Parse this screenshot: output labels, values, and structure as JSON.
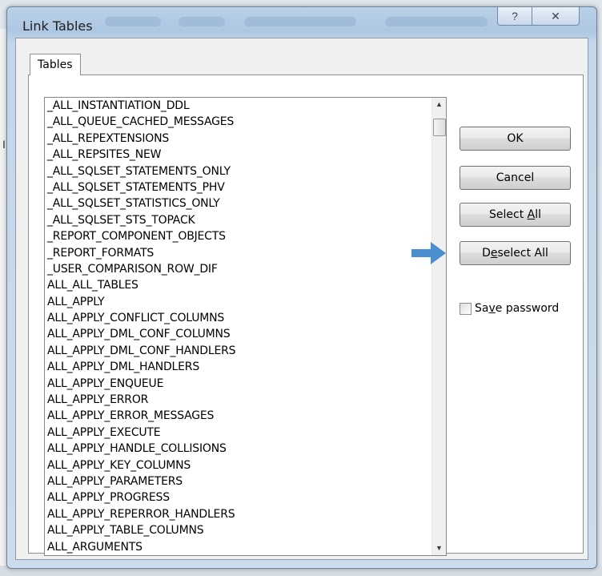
{
  "dialog": {
    "title": "Link Tables",
    "help_icon": "question-mark-icon",
    "close_icon": "close-icon",
    "help_glyph": "?",
    "close_glyph": "✕"
  },
  "tab": {
    "label": "Tables"
  },
  "tables": [
    "_ALL_INSTANTIATION_DDL",
    "_ALL_QUEUE_CACHED_MESSAGES",
    "_ALL_REPEXTENSIONS",
    "_ALL_REPSITES_NEW",
    "_ALL_SQLSET_STATEMENTS_ONLY",
    "_ALL_SQLSET_STATEMENTS_PHV",
    "_ALL_SQLSET_STATISTICS_ONLY",
    "_ALL_SQLSET_STS_TOPACK",
    "_REPORT_COMPONENT_OBJECTS",
    "_REPORT_FORMATS",
    "_USER_COMPARISON_ROW_DIF",
    "ALL_ALL_TABLES",
    "ALL_APPLY",
    "ALL_APPLY_CONFLICT_COLUMNS",
    "ALL_APPLY_DML_CONF_COLUMNS",
    "ALL_APPLY_DML_CONF_HANDLERS",
    "ALL_APPLY_DML_HANDLERS",
    "ALL_APPLY_ENQUEUE",
    "ALL_APPLY_ERROR",
    "ALL_APPLY_ERROR_MESSAGES",
    "ALL_APPLY_EXECUTE",
    "ALL_APPLY_HANDLE_COLLISIONS",
    "ALL_APPLY_KEY_COLUMNS",
    "ALL_APPLY_PARAMETERS",
    "ALL_APPLY_PROGRESS",
    "ALL_APPLY_REPERROR_HANDLERS",
    "ALL_APPLY_TABLE_COLUMNS",
    "ALL_ARGUMENTS"
  ],
  "buttons": {
    "ok": "OK",
    "cancel": "Cancel",
    "select_all_pre": "Select ",
    "select_all_key": "A",
    "select_all_post": "ll",
    "deselect_all_pre": "D",
    "deselect_all_key": "e",
    "deselect_all_post": "select All"
  },
  "save_password": {
    "pre": "Sa",
    "key": "v",
    "post": "e password",
    "checked": false
  },
  "annotation": {
    "icon": "right-arrow-icon",
    "color": "#4a8fd0"
  },
  "scrollbar": {
    "up_icon": "scroll-up-arrow-icon",
    "down_icon": "scroll-down-arrow-icon"
  },
  "background": {
    "fragment": "I"
  }
}
